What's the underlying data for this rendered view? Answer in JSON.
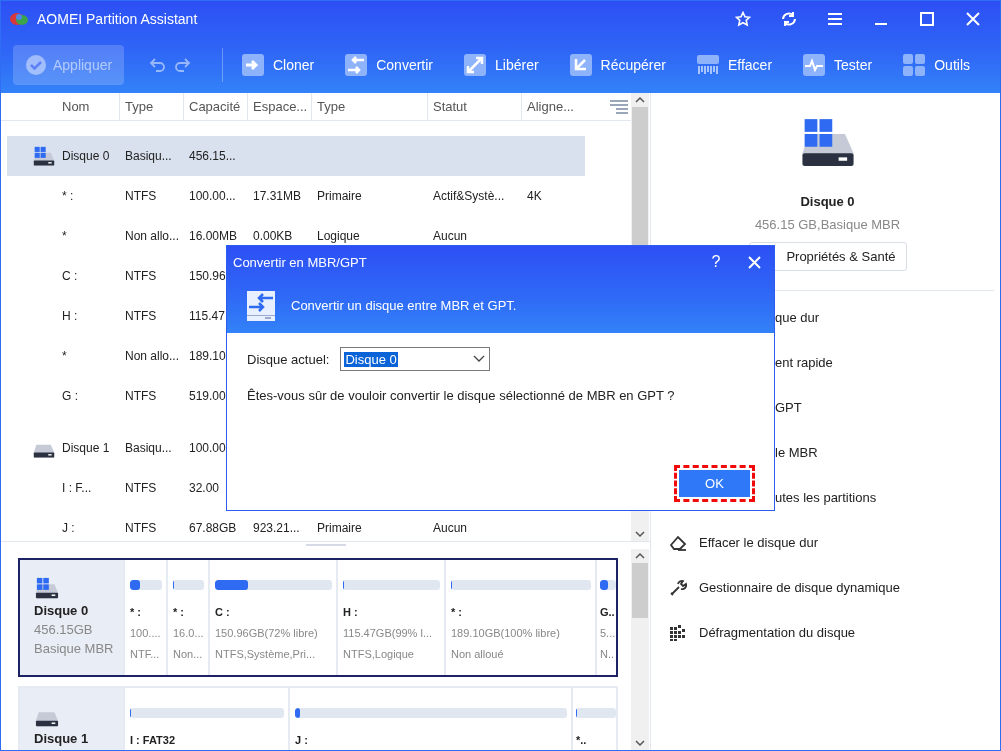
{
  "window": {
    "title": "AOMEI Partition Assistant"
  },
  "toolbar": {
    "apply": {
      "label": "Appliquer",
      "disabled": true
    },
    "tools": [
      {
        "label": "Cloner",
        "kind": "clone"
      },
      {
        "label": "Convertir",
        "kind": "convert"
      },
      {
        "label": "Libérer",
        "kind": "free"
      },
      {
        "label": "Récupérer",
        "kind": "recover"
      },
      {
        "label": "Effacer",
        "kind": "wipe"
      },
      {
        "label": "Tester",
        "kind": "test"
      },
      {
        "label": "Outils",
        "kind": "tools"
      }
    ]
  },
  "table": {
    "columns": [
      "Nom",
      "Type",
      "Capacité",
      "Espace...",
      "Type",
      "Statut",
      "Aligne..."
    ],
    "rows": [
      {
        "kind": "disk",
        "system": true,
        "selected": true,
        "cells": [
          "Disque 0",
          "Basiqu...",
          "456.15..."
        ]
      },
      {
        "kind": "partition",
        "selected": false,
        "cells": [
          "* :",
          "NTFS",
          "100.00...",
          "17.31MB",
          "Primaire",
          "Actif&Systè...",
          "4K"
        ]
      },
      {
        "kind": "partition",
        "selected": false,
        "cells": [
          "*",
          "Non allo...",
          "16.00MB",
          "0.00KB",
          "Logique",
          "Aucun"
        ]
      },
      {
        "kind": "partition",
        "selected": false,
        "cells": [
          "C :",
          "NTFS",
          "150.96"
        ]
      },
      {
        "kind": "partition",
        "selected": false,
        "cells": [
          "H :",
          "NTFS",
          "115.47"
        ]
      },
      {
        "kind": "partition",
        "selected": false,
        "cells": [
          "*",
          "Non allo...",
          "189.10"
        ]
      },
      {
        "kind": "partition",
        "selected": false,
        "cells": [
          "G :",
          "NTFS",
          "519.00"
        ]
      },
      {
        "kind": "disk",
        "system": false,
        "selected": false,
        "cells": [
          "Disque 1",
          "Basiqu...",
          "100.00"
        ]
      },
      {
        "kind": "partition",
        "selected": false,
        "cells": [
          "I : F...",
          "NTFS",
          "32.00"
        ]
      },
      {
        "kind": "partition",
        "selected": false,
        "cells": [
          "J :",
          "NTFS",
          "67.88GB",
          "923.21...",
          "Primaire",
          "Aucun"
        ]
      }
    ]
  },
  "disk_map": {
    "cards": [
      {
        "name": "Disque 0",
        "size": "456.15GB",
        "type": "Basique MBR",
        "system": true,
        "selected": true,
        "partitions": [
          {
            "name": "* :",
            "size": "100....",
            "fs": "NTF...",
            "level": 0.3
          },
          {
            "name": "* :",
            "size": "16.0...",
            "fs": "Non...",
            "level": 0
          },
          {
            "name": "C :",
            "size": "150.96GB(72% libre)",
            "fs": "NTFS,Système,Pri...",
            "level": 0.28
          },
          {
            "name": "H :",
            "size": "115.47GB(99% l...",
            "fs": "NTFS,Logique",
            "level": 0
          },
          {
            "name": "* :",
            "size": "189.10GB(100% libre)",
            "fs": "Non alloué",
            "level": 0
          },
          {
            "name": "G..",
            "size": "5...",
            "fs": "N..",
            "level": 0.5
          }
        ]
      },
      {
        "name": "Disque 1",
        "system": false,
        "selected": false,
        "partitions": [
          {
            "name": "I : FAT32",
            "level": 0
          },
          {
            "name": "J :",
            "level": 0.02
          },
          {
            "name": "*..",
            "level": 0
          }
        ]
      }
    ]
  },
  "side_panel": {
    "disk_name": "Disque 0",
    "disk_info": "456.15 GB,Basique MBR",
    "button": "Propriétés & Santé",
    "actions": [
      {
        "label": "que dur",
        "kind": "covered"
      },
      {
        "label": "ent rapide",
        "kind": "covered"
      },
      {
        "label": "GPT",
        "kind": "covered"
      },
      {
        "label": "le MBR",
        "kind": "covered"
      },
      {
        "label": "utes les partitions",
        "kind": "covered"
      },
      {
        "label": "Effacer le disque dur",
        "kind": "wipe"
      },
      {
        "label": "Gestionnaire de disque dynamique",
        "kind": "dynamic"
      },
      {
        "label": "Défragmentation du disque",
        "kind": "defrag"
      }
    ]
  },
  "dialog": {
    "title": "Convertir en MBR/GPT",
    "help": "?",
    "subtitle": "Convertir un disque entre MBR et GPT.",
    "field_label": "Disque actuel:",
    "field_value": "Disque 0",
    "question": "Êtes-vous sûr de vouloir convertir le disque sélectionné de MBR en GPT ?",
    "ok": "OK"
  }
}
